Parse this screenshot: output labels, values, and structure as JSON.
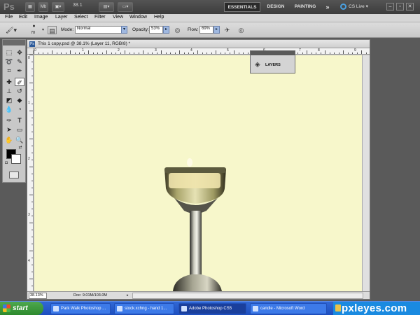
{
  "app": {
    "logo": "Ps",
    "zoom_display": "38.1",
    "workspaces": [
      "ESSENTIALS",
      "DESIGN",
      "PAINTING"
    ],
    "more": "»",
    "cs_live": "CS Live"
  },
  "menu": [
    "File",
    "Edit",
    "Image",
    "Layer",
    "Select",
    "Filter",
    "View",
    "Window",
    "Help"
  ],
  "options": {
    "brush_size": "70",
    "mode_label": "Mode:",
    "mode_value": "Normal",
    "opacity_label": "Opacity:",
    "opacity_value": "53%",
    "flow_label": "Flow:",
    "flow_value": "69%"
  },
  "document": {
    "ps_icon": "Ps",
    "title": "This 1 copy.psd @ 38.1% (Layer 11, RGB/8) *",
    "ruler_top": [
      "0",
      "1",
      "2",
      "3",
      "4",
      "5",
      "6",
      "7",
      "8",
      "9"
    ],
    "ruler_left": [
      "0",
      "1",
      "2",
      "3",
      "4"
    ],
    "status_zoom": "38.13%",
    "status_doc": "Doc: 9.01M/103.0M"
  },
  "layers_panel": {
    "label": "LAYERS"
  },
  "taskbar": {
    "start": "start",
    "tasks": [
      "Park Walk Photoshop ...",
      "stock.xchng - hand 1...",
      "Adobe Photoshop CS5",
      "candle - Microsoft Word"
    ],
    "watermark": "pxleyes.com"
  },
  "colors": {
    "canvas": "#f7f7cb",
    "taskbar": "#245edb",
    "start": "#3a9a3a"
  }
}
